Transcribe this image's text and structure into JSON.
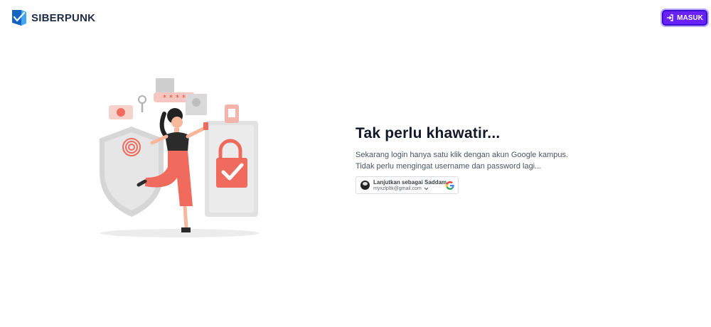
{
  "header": {
    "brand_name": "SIBERPUNK",
    "login_button_label": "MASUK"
  },
  "main": {
    "headline": "Tak perlu khawatir...",
    "description_line1": "Sekarang login hanya satu klik dengan akun Google kampus.",
    "description_line2": "Tidak perlu mengingat username dan password lagi..."
  },
  "google_signin": {
    "continue_label": "Lanjutkan sebagai Saddam",
    "email": "myxzlpltk@gmail.com"
  },
  "icons": {
    "brand": "shield-check-logo-icon",
    "login": "sign-in-icon",
    "google": "google-icon",
    "chevron": "chevron-down-icon"
  },
  "colors": {
    "accent": "#6a21ff",
    "illustration_accent": "#f06b5d",
    "brand_blue": "#1e88e5"
  }
}
